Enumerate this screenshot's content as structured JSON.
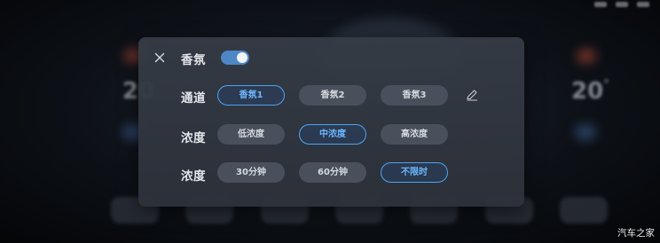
{
  "background": {
    "left_temp": "20",
    "right_temp": "20",
    "right_temp_unit": "°"
  },
  "panel": {
    "title": "香氛",
    "toggle_on": true,
    "close_icon": "close-icon",
    "edit_icon": "pencil-icon",
    "rows": [
      {
        "label": "通道",
        "options": [
          "香氛1",
          "香氛2",
          "香氛3"
        ],
        "selected_index": 0
      },
      {
        "label": "浓度",
        "options": [
          "低浓度",
          "中浓度",
          "高浓度"
        ],
        "selected_index": 1
      },
      {
        "label": "浓度",
        "options": [
          "30分钟",
          "60分钟",
          "不限时"
        ],
        "selected_index": 2
      }
    ]
  },
  "watermark": "汽车之家",
  "colors": {
    "accent": "#4fa3f0",
    "toggle_on": "#4f86c6",
    "panel_bg": "#363c46",
    "option_bg": "#4a505b"
  }
}
